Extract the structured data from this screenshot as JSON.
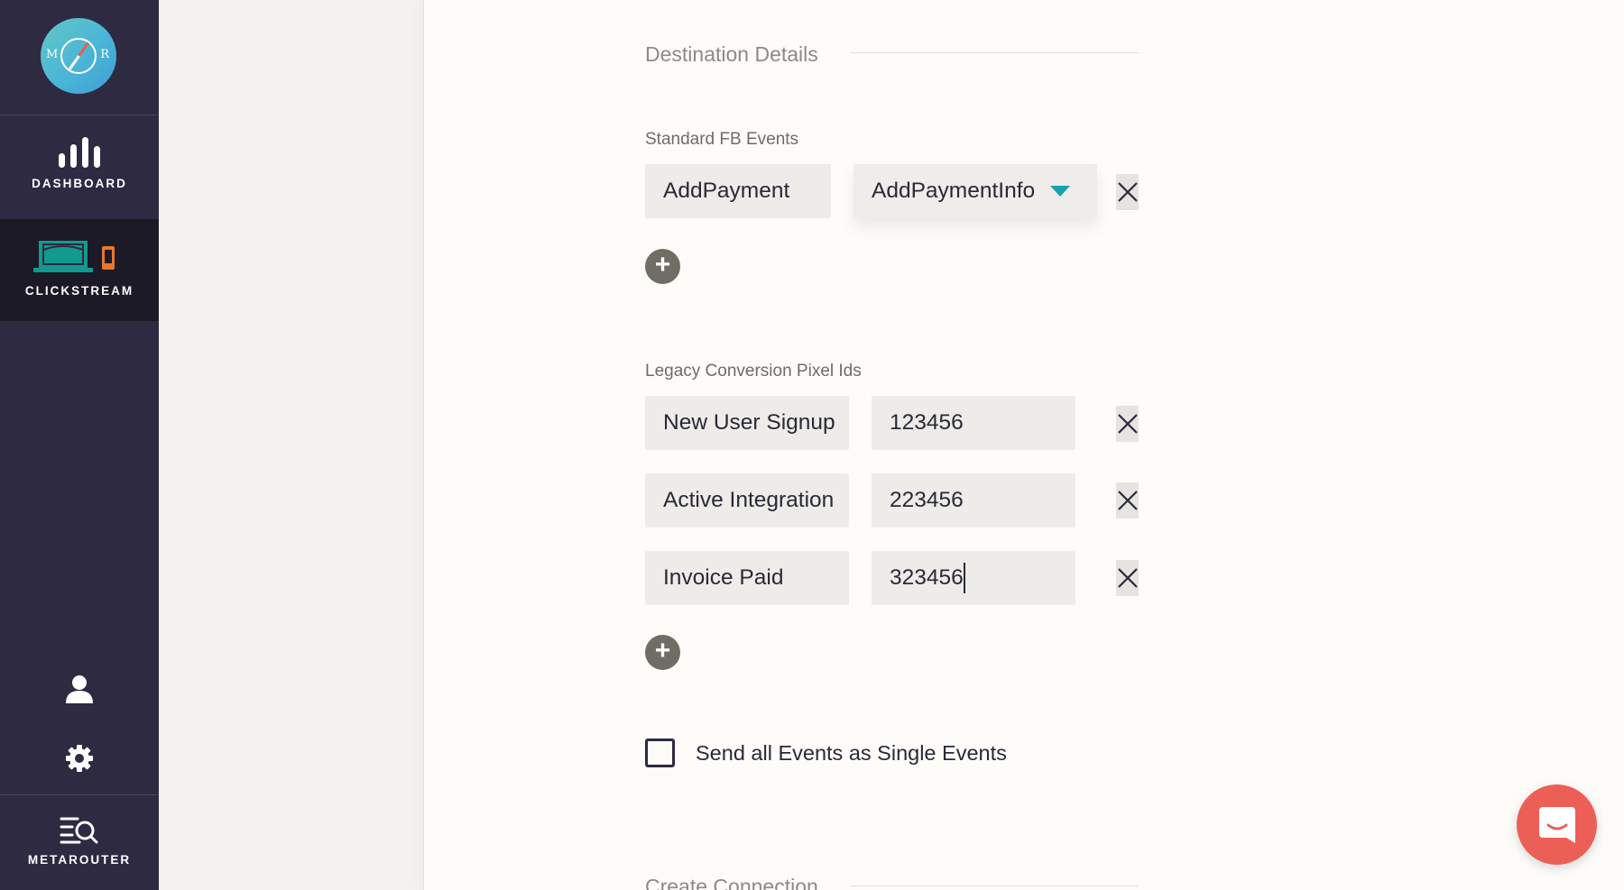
{
  "sidebar": {
    "logo_letters": [
      "M",
      "R"
    ],
    "items": [
      {
        "label": "DASHBOARD",
        "icon": "bar-chart-icon"
      },
      {
        "label": "CLICKSTREAM",
        "icon": "clickstream-devices-icon",
        "active": true
      },
      {
        "label": "",
        "icon": "user-icon"
      },
      {
        "label": "",
        "icon": "gear-icon"
      },
      {
        "label": "METAROUTER",
        "icon": "metarouter-search-list-icon"
      }
    ]
  },
  "destination_details": {
    "title": "Destination Details",
    "standard_fb_events": {
      "label": "Standard FB Events",
      "rows": [
        {
          "name": "AddPayment",
          "event": "AddPaymentInfo"
        }
      ]
    },
    "legacy_pixel_ids": {
      "label": "Legacy Conversion Pixel Ids",
      "rows": [
        {
          "name": "New User Signup",
          "id": "123456"
        },
        {
          "name": "Active Integration",
          "id": "223456"
        },
        {
          "name": "Invoice Paid",
          "id": "323456"
        }
      ]
    },
    "single_events_checkbox": {
      "label": "Send all Events as Single Events",
      "checked": false
    }
  },
  "create_connection": {
    "title": "Create Connection"
  },
  "colors": {
    "sidebar_bg": "#2e2a42",
    "sidebar_active_bg": "#1b1a26",
    "dropdown_accent": "#16a2b0",
    "chat_button": "#ec5f57"
  }
}
